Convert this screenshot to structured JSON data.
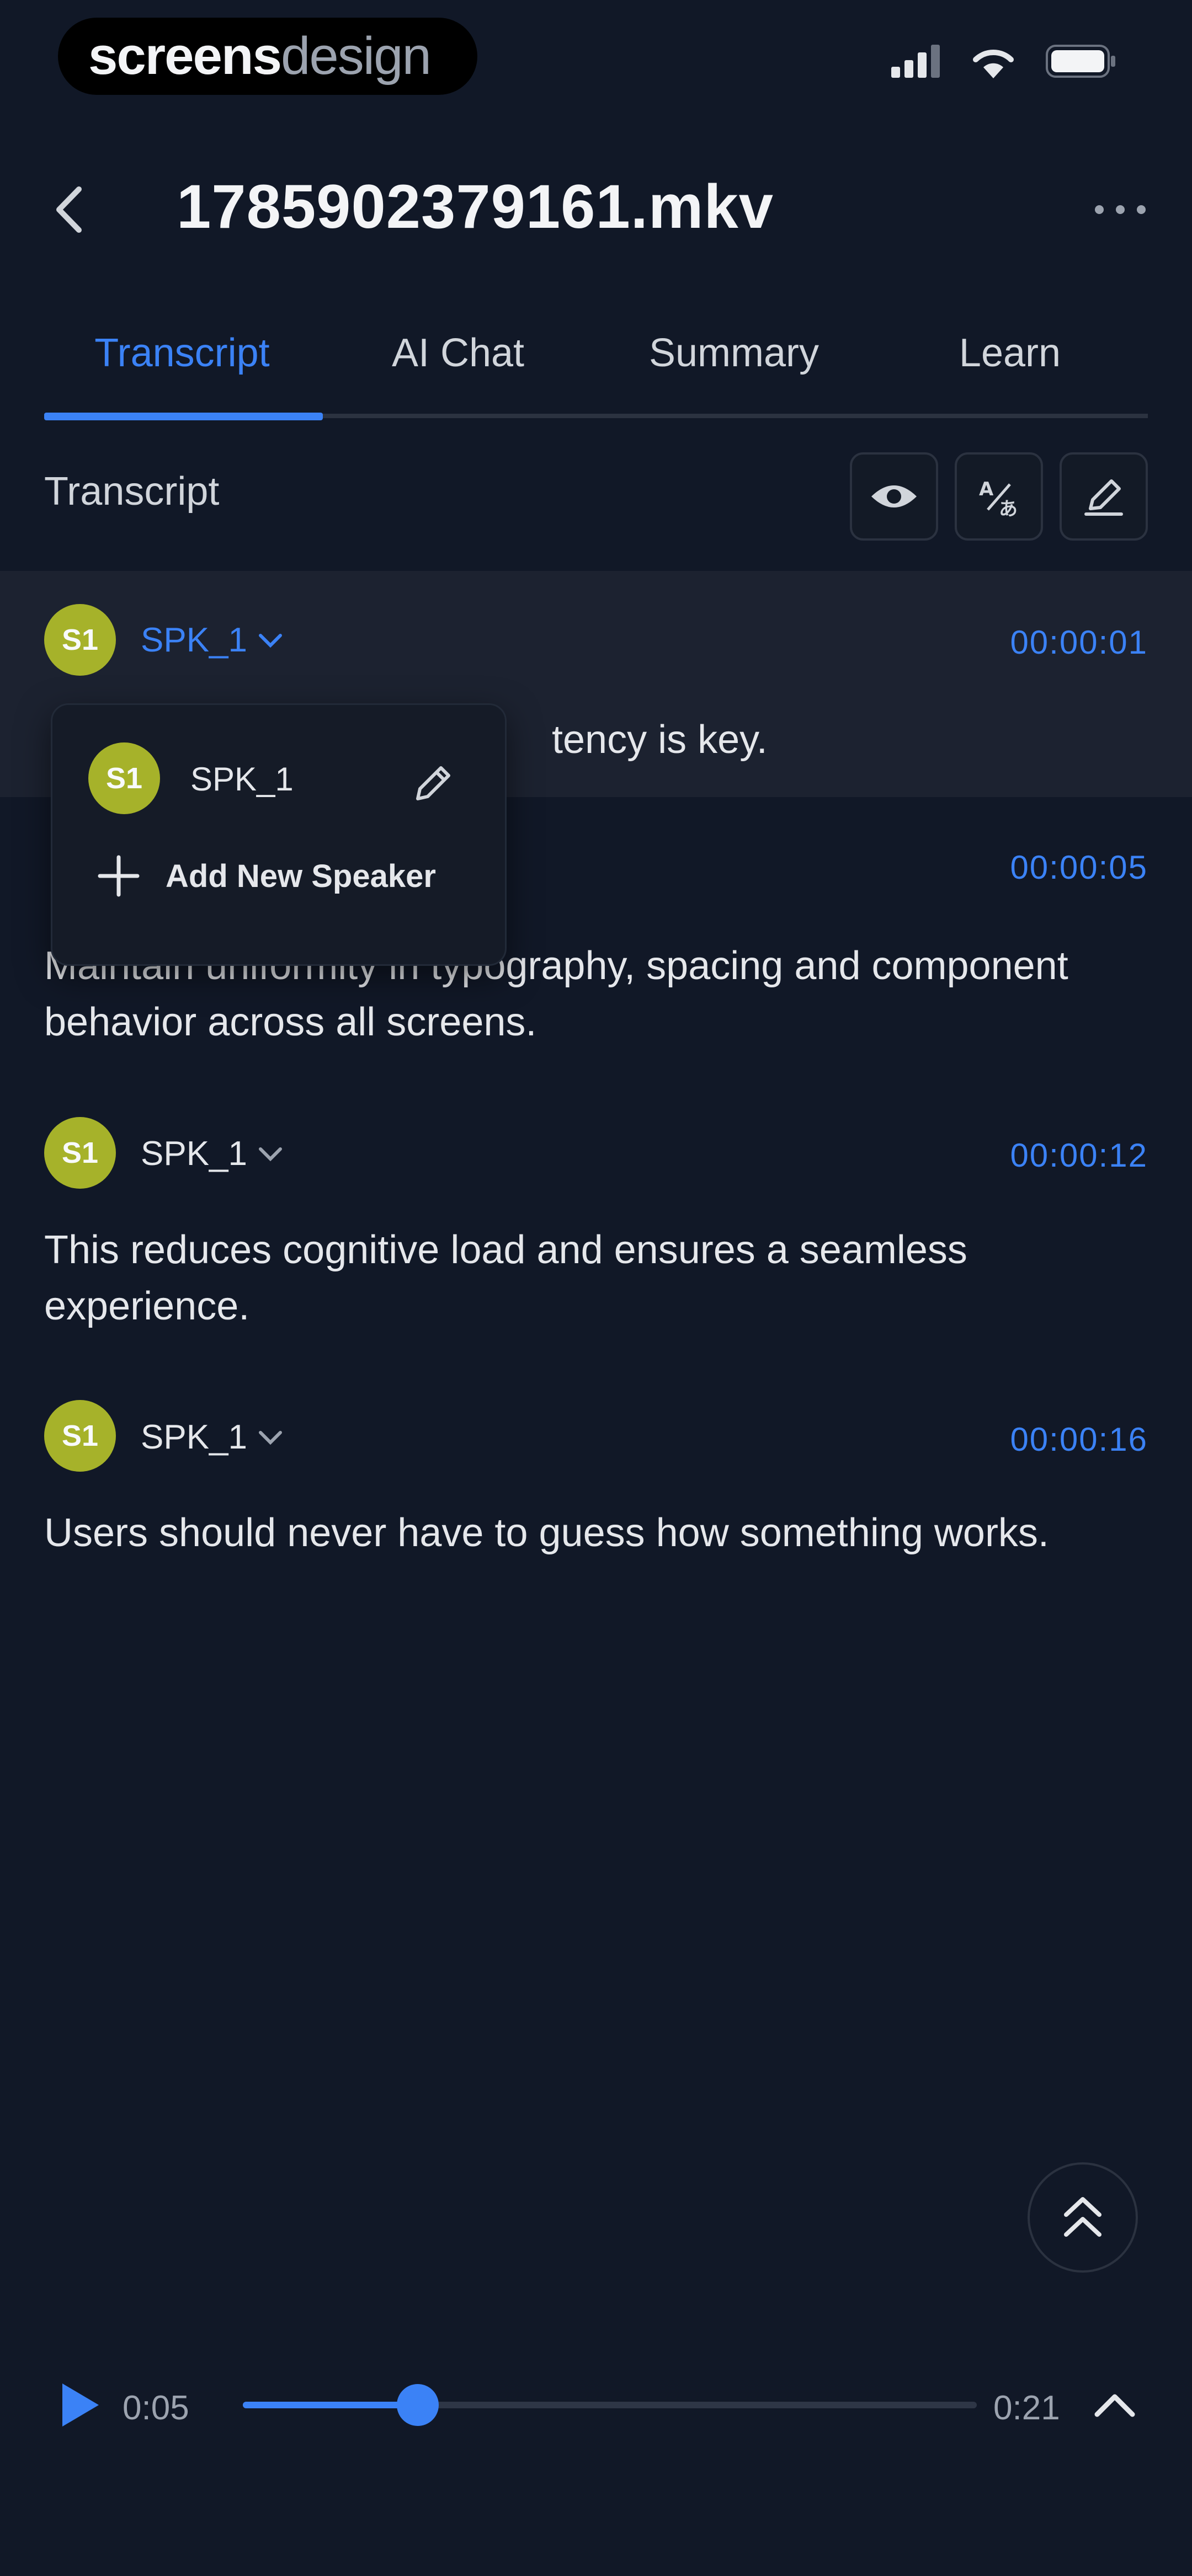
{
  "status_bar": {
    "brand_bold": "screens",
    "brand_light": "design"
  },
  "header": {
    "title": "1785902379161.mkv"
  },
  "tabs": [
    {
      "label": "Transcript",
      "active": true
    },
    {
      "label": "AI Chat"
    },
    {
      "label": "Summary"
    },
    {
      "label": "Learn"
    }
  ],
  "toolbar": {
    "label": "Transcript"
  },
  "segments": [
    {
      "avatar": "S1",
      "speaker": "SPK_1",
      "time": "00:00:01",
      "text": "tency is key."
    },
    {
      "time": "00:00:05",
      "text": "Maintain uniformity in typography, spacing and component behavior across all screens."
    },
    {
      "avatar": "S1",
      "speaker": "SPK_1",
      "time": "00:00:12",
      "text": "This reduces cognitive load and ensures a seamless experience."
    },
    {
      "avatar": "S1",
      "speaker": "SPK_1",
      "time": "00:00:16",
      "text": "Users should never have to guess how something works."
    }
  ],
  "speaker_menu": {
    "items": [
      {
        "avatar": "S1",
        "name": "SPK_1"
      }
    ],
    "add_label": "Add New Speaker"
  },
  "player": {
    "current": "0:05",
    "total": "0:21",
    "progress": 0.238
  },
  "colors": {
    "accent": "#3b82f6",
    "avatar": "#a6b22a",
    "background": "#111827"
  }
}
